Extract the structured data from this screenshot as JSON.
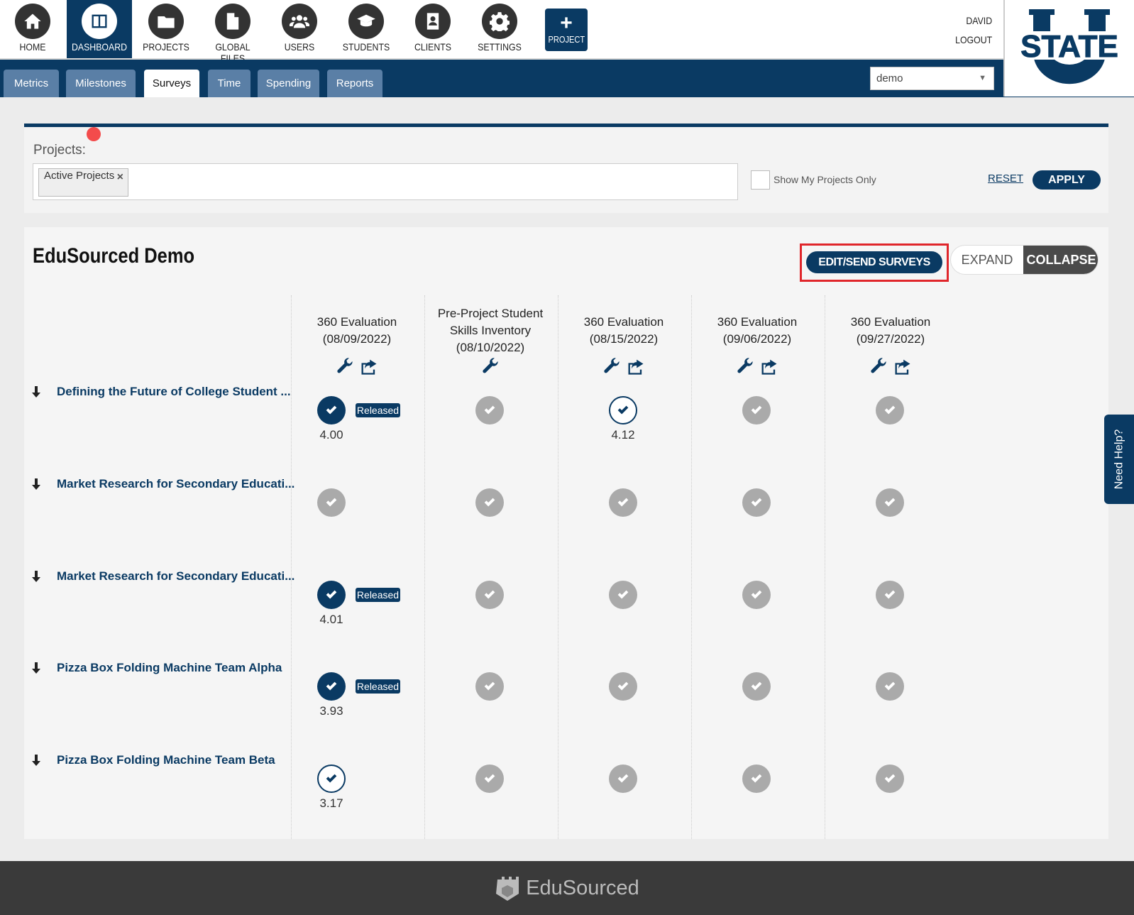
{
  "nav": {
    "items": [
      {
        "label": "HOME",
        "icon": "home-icon"
      },
      {
        "label": "DASHBOARD",
        "icon": "dashboard-icon",
        "active": true
      },
      {
        "label": "PROJECTS",
        "icon": "folder-icon"
      },
      {
        "label": "GLOBAL FILES",
        "icon": "file-icon"
      },
      {
        "label": "USERS",
        "icon": "users-icon"
      },
      {
        "label": "STUDENTS",
        "icon": "graduation-cap-icon"
      },
      {
        "label": "CLIENTS",
        "icon": "contact-card-icon"
      },
      {
        "label": "SETTINGS",
        "icon": "gear-icon"
      }
    ],
    "project_button": {
      "plus": "+",
      "label": "PROJECT"
    },
    "user_name": "DAVID",
    "logout": "LOGOUT",
    "logo_text": "STATE"
  },
  "subnav": {
    "tabs": [
      "Metrics",
      "Milestones",
      "Surveys",
      "Time",
      "Spending",
      "Reports"
    ],
    "active_tab": "Surveys",
    "company_select": "demo"
  },
  "filter": {
    "label": "Projects:",
    "tags": [
      "Active Projects"
    ],
    "tag_remove": "×",
    "show_my_projects": "Show My Projects Only",
    "reset": "RESET",
    "apply": "APPLY"
  },
  "surveys": {
    "title": "EduSourced Demo",
    "edit_send": "EDIT/SEND SURVEYS",
    "expand": "EXPAND",
    "collapse": "COLLAPSE",
    "released_label": "Released",
    "columns": [
      {
        "line1": "360 Evaluation",
        "line2": "(08/09/2022)",
        "line3": "",
        "share": true
      },
      {
        "line1": "Pre-Project Student",
        "line2": "Skills Inventory",
        "line3": "(08/10/2022)",
        "share": false
      },
      {
        "line1": "360 Evaluation",
        "line2": "(08/15/2022)",
        "line3": "",
        "share": true
      },
      {
        "line1": "360 Evaluation",
        "line2": "(09/06/2022)",
        "line3": "",
        "share": true
      },
      {
        "line1": "360 Evaluation",
        "line2": "(09/27/2022)",
        "line3": "",
        "share": true
      }
    ],
    "rows": [
      {
        "name": "Defining the Future of College Student ...",
        "cells": [
          {
            "state": "done",
            "released": true,
            "score": "4.00"
          },
          {
            "state": "none"
          },
          {
            "state": "open",
            "score": "4.12"
          },
          {
            "state": "none"
          },
          {
            "state": "none"
          }
        ]
      },
      {
        "name": "Market Research for Secondary Educati...",
        "cells": [
          {
            "state": "none"
          },
          {
            "state": "none"
          },
          {
            "state": "none"
          },
          {
            "state": "none"
          },
          {
            "state": "none"
          }
        ]
      },
      {
        "name": "Market Research for Secondary Educati...",
        "cells": [
          {
            "state": "done",
            "released": true,
            "score": "4.01"
          },
          {
            "state": "none"
          },
          {
            "state": "none"
          },
          {
            "state": "none"
          },
          {
            "state": "none"
          }
        ]
      },
      {
        "name": "Pizza Box Folding Machine Team Alpha",
        "cells": [
          {
            "state": "done",
            "released": true,
            "score": "3.93"
          },
          {
            "state": "none"
          },
          {
            "state": "none"
          },
          {
            "state": "none"
          },
          {
            "state": "none"
          }
        ]
      },
      {
        "name": "Pizza Box Folding Machine Team Beta",
        "cells": [
          {
            "state": "open",
            "score": "3.17"
          },
          {
            "state": "none"
          },
          {
            "state": "none"
          },
          {
            "state": "none"
          },
          {
            "state": "none"
          }
        ]
      }
    ]
  },
  "help": {
    "label": "Need Help?"
  },
  "footer": {
    "brand": "EduSourced"
  },
  "colors": {
    "primary": "#0a3a63",
    "tab": "#5a7fa6",
    "highlight": "#e0262b",
    "footer": "#3a3a3a"
  }
}
